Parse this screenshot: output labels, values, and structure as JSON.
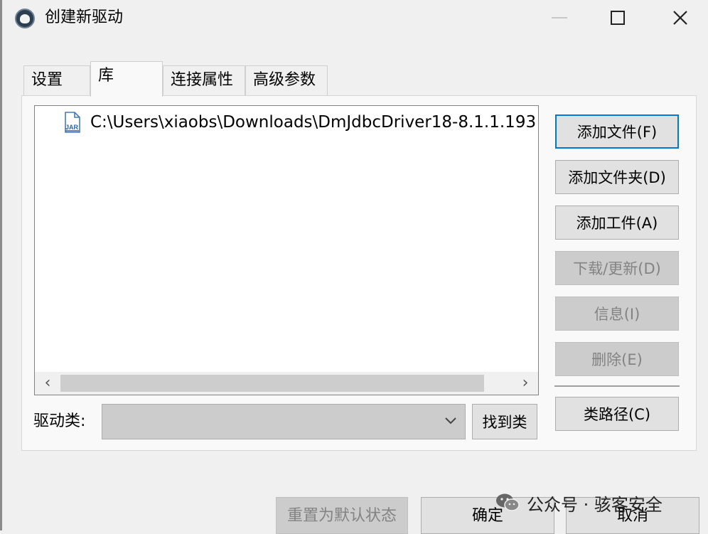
{
  "window": {
    "title": "创建新驱动"
  },
  "tabs": [
    {
      "label": "设置"
    },
    {
      "label": "库"
    },
    {
      "label": "连接属性"
    },
    {
      "label": "高级参数"
    }
  ],
  "library": {
    "jar_path": "C:\\Users\\xiaobs\\Downloads\\DmJdbcDriver18-8.1.1.193"
  },
  "buttons": {
    "add_file": "添加文件(F)",
    "add_folder": "添加文件夹(D)",
    "add_artifact": "添加工件(A)",
    "download_update": "下载/更新(D)",
    "info": "信息(I)",
    "delete": "删除(E)",
    "classpath": "类路径(C)",
    "find_class": "找到类",
    "reset_defaults": "重置为默认状态",
    "ok": "确定",
    "cancel": "取消"
  },
  "driver_class": {
    "label": "驱动类:",
    "value": ""
  },
  "watermark": {
    "text": "公众号 · 骇客安全"
  },
  "icons": {
    "app": "dbeaver-beaver-icon",
    "jar": "jar-file-icon",
    "wechat": "wechat-icon"
  },
  "colors": {
    "accent": "#0078d7",
    "window_bg": "#f0f0f0",
    "disabled_bg": "#cccccc",
    "disabled_text": "#838383"
  }
}
